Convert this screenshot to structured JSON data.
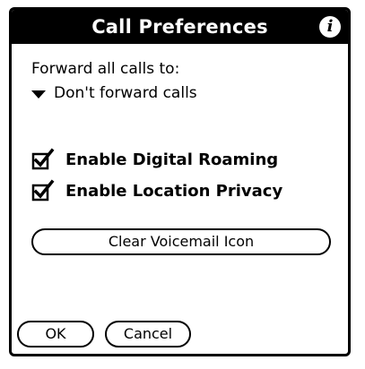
{
  "dialog": {
    "title": "Call Preferences",
    "info_glyph": "i",
    "info_icon": "info-icon"
  },
  "forward": {
    "label": "Forward all calls to:",
    "selected": "Don't forward calls"
  },
  "options": [
    {
      "label": "Enable Digital Roaming",
      "checked": true
    },
    {
      "label": "Enable Location Privacy",
      "checked": true
    }
  ],
  "buttons": {
    "clear_voicemail": "Clear Voicemail Icon",
    "ok": "OK",
    "cancel": "Cancel"
  },
  "colors": {
    "foreground": "#000000",
    "background": "#ffffff"
  }
}
